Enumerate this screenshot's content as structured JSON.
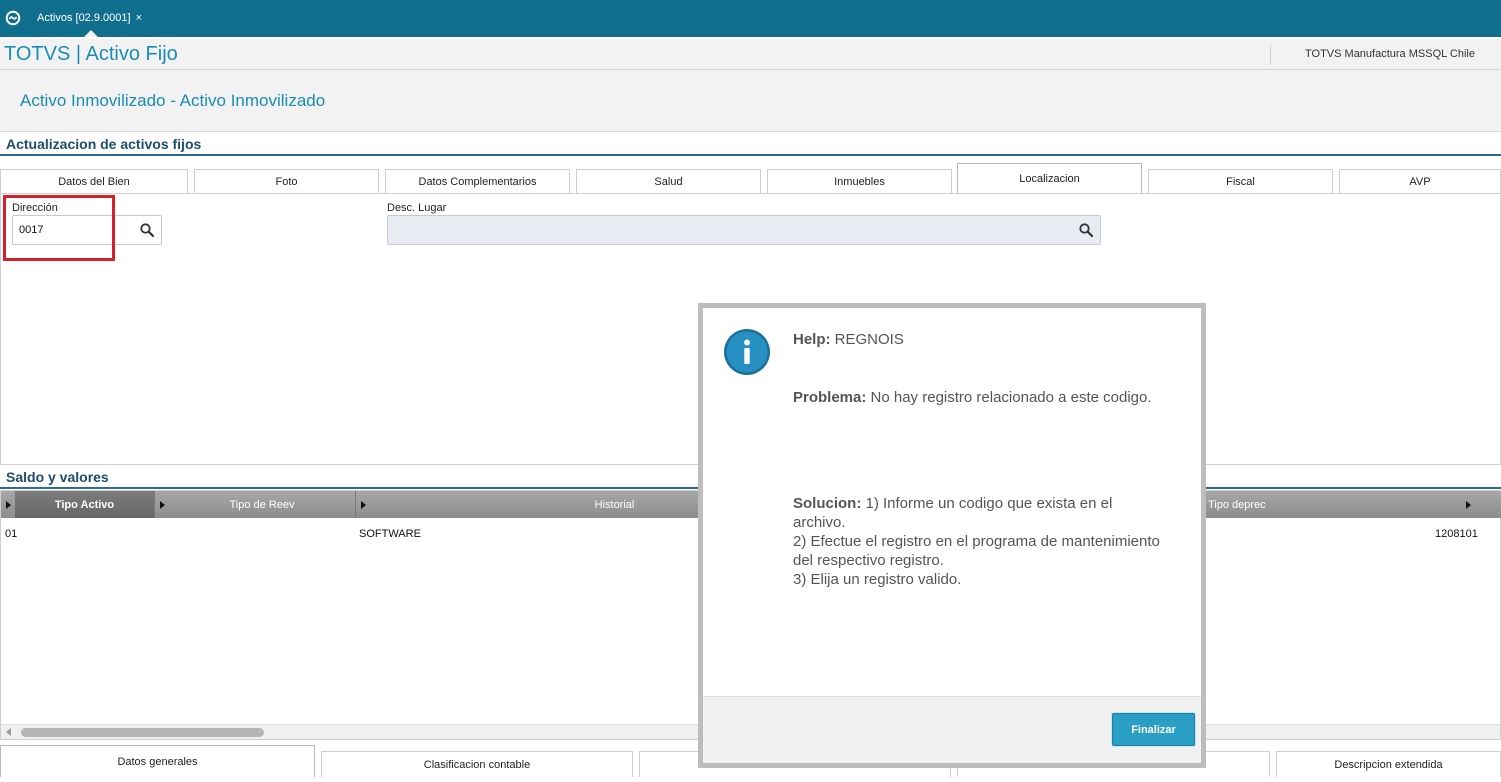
{
  "topbar": {
    "tab_label": "Activos [02.9.0001]",
    "tab_close": "×"
  },
  "header": {
    "app_title": "TOTVS | Activo Fijo",
    "environment": "TOTVS Manufactura MSSQL Chile"
  },
  "page": {
    "title": "Activo Inmovilizado - Activo Inmovilizado"
  },
  "section1": {
    "title": "Actualizacion de activos fijos"
  },
  "tabs": [
    {
      "label": "Datos del Bien"
    },
    {
      "label": "Foto"
    },
    {
      "label": "Datos Complementarios"
    },
    {
      "label": "Salud"
    },
    {
      "label": "Inmuebles"
    },
    {
      "label": "Localizacion",
      "active": true
    },
    {
      "label": "Fiscal"
    },
    {
      "label": "AVP"
    }
  ],
  "form": {
    "direccion_label": "Dirección",
    "direccion_value": "0017",
    "desc_lugar_label": "Desc. Lugar",
    "desc_lugar_value": ""
  },
  "section2": {
    "title": "Saldo y valores"
  },
  "grid": {
    "columns": [
      "Tipo Activo",
      "Tipo de Reev",
      "Historial",
      "Tipo deprec"
    ],
    "row": {
      "tipo_activo": "01",
      "historial": "SOFTWARE",
      "last": "1208101"
    }
  },
  "bottom_tabs": [
    {
      "label": "Datos generales",
      "active": true
    },
    {
      "label": "Clasificacion contable"
    },
    {
      "label": ""
    },
    {
      "label": ""
    },
    {
      "label": "Descripcion extendida"
    }
  ],
  "modal": {
    "help_label": "Help:",
    "help_value": "REGNOIS",
    "problema_label": "Problema:",
    "problema_value": "No hay registro relacionado a este codigo.",
    "solucion_label": "Solucion:",
    "solucion_line1": "1) Informe un codigo que exista en el",
    "solucion_line2": "archivo.",
    "solucion_line3": "2) Efectue el registro en el programa de mantenimiento",
    "solucion_line4": "del respectivo registro.",
    "solucion_line5": "3) Elija un registro valido.",
    "button_label": "Finalizar"
  },
  "colors": {
    "topbar": "#116f8e",
    "accent": "#1b8cb5",
    "highlight": "#d8202a",
    "button": "#2a9fc6"
  }
}
